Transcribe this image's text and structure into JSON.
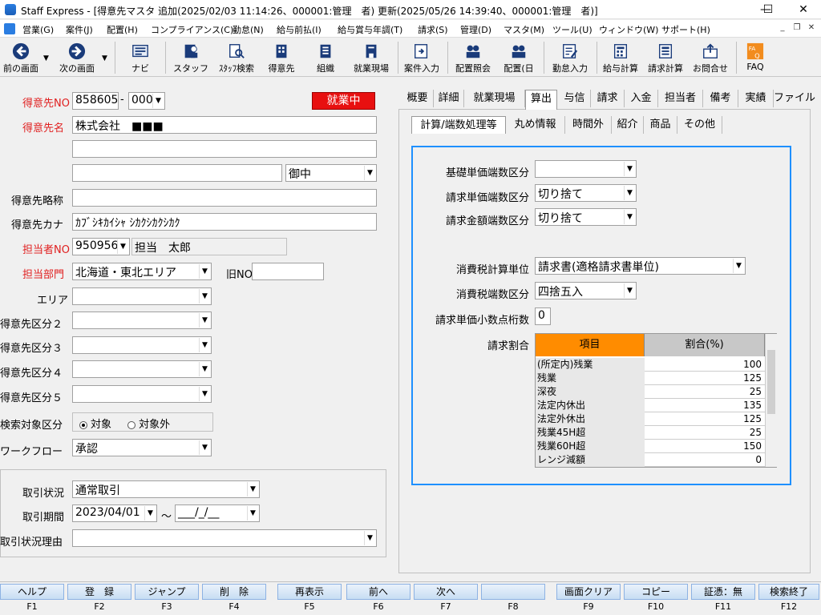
{
  "window": {
    "title": "Staff Express - [得意先マスタ 追加(2025/02/03 11:14:26、000001:管理　者) 更新(2025/05/26 14:39:40、000001:管理　者)]",
    "minimize": "—",
    "maximize": "☐",
    "close": "✕"
  },
  "menu": [
    "営業(G)",
    "案件(J)",
    "配置(H)",
    "コンプライアンス(C)",
    "勤怠(N)",
    "給与前払(I)",
    "給与賞与年調(T)",
    "請求(S)",
    "管理(D)",
    "マスタ(M)",
    "ツール(U)",
    "ウィンドウ(W)",
    "サポート(H)"
  ],
  "mdi": {
    "min": "_",
    "restore": "❐",
    "close": "✕"
  },
  "toolbar": [
    {
      "label": "前の画面",
      "icon": "arrow-left-icon"
    },
    {
      "label": "次の画面",
      "icon": "arrow-right-icon"
    },
    {
      "label": "ナビ",
      "icon": "navi-icon"
    },
    {
      "label": "スタッフ",
      "icon": "staff-icon"
    },
    {
      "label": "ｽﾀｯﾌ検索",
      "icon": "staff-search-icon"
    },
    {
      "label": "得意先",
      "icon": "customer-icon"
    },
    {
      "label": "組織",
      "icon": "organization-icon"
    },
    {
      "label": "就業現場",
      "icon": "worksite-icon"
    },
    {
      "label": "案件入力",
      "icon": "case-input-icon"
    },
    {
      "label": "配置照会",
      "icon": "assignment-inquiry-icon"
    },
    {
      "label": "配置(日",
      "icon": "assignment-day-icon"
    },
    {
      "label": "勤怠入力",
      "icon": "attendance-input-icon"
    },
    {
      "label": "給与計算",
      "icon": "payroll-icon"
    },
    {
      "label": "請求計算",
      "icon": "billing-icon"
    },
    {
      "label": "お問合せ",
      "icon": "inquiry-icon"
    },
    {
      "label": "FAQ",
      "icon": "faq-icon"
    }
  ],
  "form": {
    "customer_no_label": "得意先NO",
    "customer_no": "858605",
    "customer_no_dash": "-",
    "customer_branch": "000",
    "status_badge": "就業中",
    "customer_name_label": "得意先名",
    "customer_name": "株式会社　■■■",
    "customer_name2": "",
    "customer_name3": "",
    "honorific": "御中",
    "short_name_label": "得意先略称",
    "short_name": "",
    "kana_label": "得意先カナ",
    "kana": "ｶﾌﾞｼｷｶｲｼｬ ｼｶｸｼｶｸｼｶｸ",
    "staff_no_label": "担当者NO",
    "staff_no": "950956",
    "staff_name": "担当　太郎",
    "dept_label": "担当部門",
    "dept": "北海道・東北エリア",
    "old_no_label": "旧NO",
    "old_no": "",
    "area_label": "エリア",
    "cat2_label": "得意先区分２",
    "cat3_label": "得意先区分３",
    "cat4_label": "得意先区分４",
    "cat5_label": "得意先区分５",
    "search_target_label": "検索対象区分",
    "search_target_on": "対象",
    "search_target_off": "対象外",
    "workflow_label": "ワークフロー",
    "workflow": "承認",
    "trade_status_label": "取引状況",
    "trade_status": "通常取引",
    "trade_period_label": "取引期間",
    "trade_start": "2023/04/01",
    "trade_tilde": "～",
    "trade_end": "___/_/__",
    "trade_reason_label": "取引状況理由",
    "trade_reason": ""
  },
  "tabs": [
    "概要",
    "詳細",
    "就業現場",
    "算出",
    "与信",
    "請求",
    "入金",
    "担当者",
    "備考",
    "実績",
    "ファイル"
  ],
  "subtabs": [
    "計算/端数処理等",
    "丸め情報",
    "時間外",
    "紹介",
    "商品",
    "その他"
  ],
  "calc": {
    "base_rounding_label": "基礎単価端数区分",
    "base_rounding": "",
    "bill_unit_rounding_label": "請求単価端数区分",
    "bill_unit_rounding": "切り捨て",
    "bill_amount_rounding_label": "請求金額端数区分",
    "bill_amount_rounding": "切り捨て",
    "tax_unit_label": "消費税計算単位",
    "tax_unit": "請求書(適格請求書単位)",
    "tax_rounding_label": "消費税端数区分",
    "tax_rounding": "四捨五入",
    "decimal_label": "請求単価小数点桁数",
    "decimal": "0",
    "ratio_label": "請求割合"
  },
  "ratio_table": {
    "headers": [
      "項目",
      "割合(%)"
    ],
    "rows": [
      [
        "(所定内)残業",
        "100"
      ],
      [
        "残業",
        "125"
      ],
      [
        "深夜",
        "25"
      ],
      [
        "法定内休出",
        "135"
      ],
      [
        "法定外休出",
        "125"
      ],
      [
        "残業45H超",
        "25"
      ],
      [
        "残業60H超",
        "150"
      ],
      [
        "レンジ減額",
        "0"
      ]
    ]
  },
  "fkeys": [
    {
      "label": "ヘルプ",
      "key": "F1"
    },
    {
      "label": "登　録",
      "key": "F2"
    },
    {
      "label": "ジャンプ",
      "key": "F3"
    },
    {
      "label": "削　除",
      "key": "F4"
    },
    {
      "label": "再表示",
      "key": "F5"
    },
    {
      "label": "前へ",
      "key": "F6"
    },
    {
      "label": "次へ",
      "key": "F7"
    },
    {
      "label": "",
      "key": "F8"
    },
    {
      "label": "画面クリア",
      "key": "F9"
    },
    {
      "label": "コピー",
      "key": "F10"
    },
    {
      "label": "証憑：無",
      "key": "F11"
    },
    {
      "label": "検索終了",
      "key": "F12"
    }
  ],
  "colors": {
    "accent": "#1e90ff",
    "required": "#e02020",
    "badge": "#e81010",
    "grid_header": "#ff8c00"
  }
}
